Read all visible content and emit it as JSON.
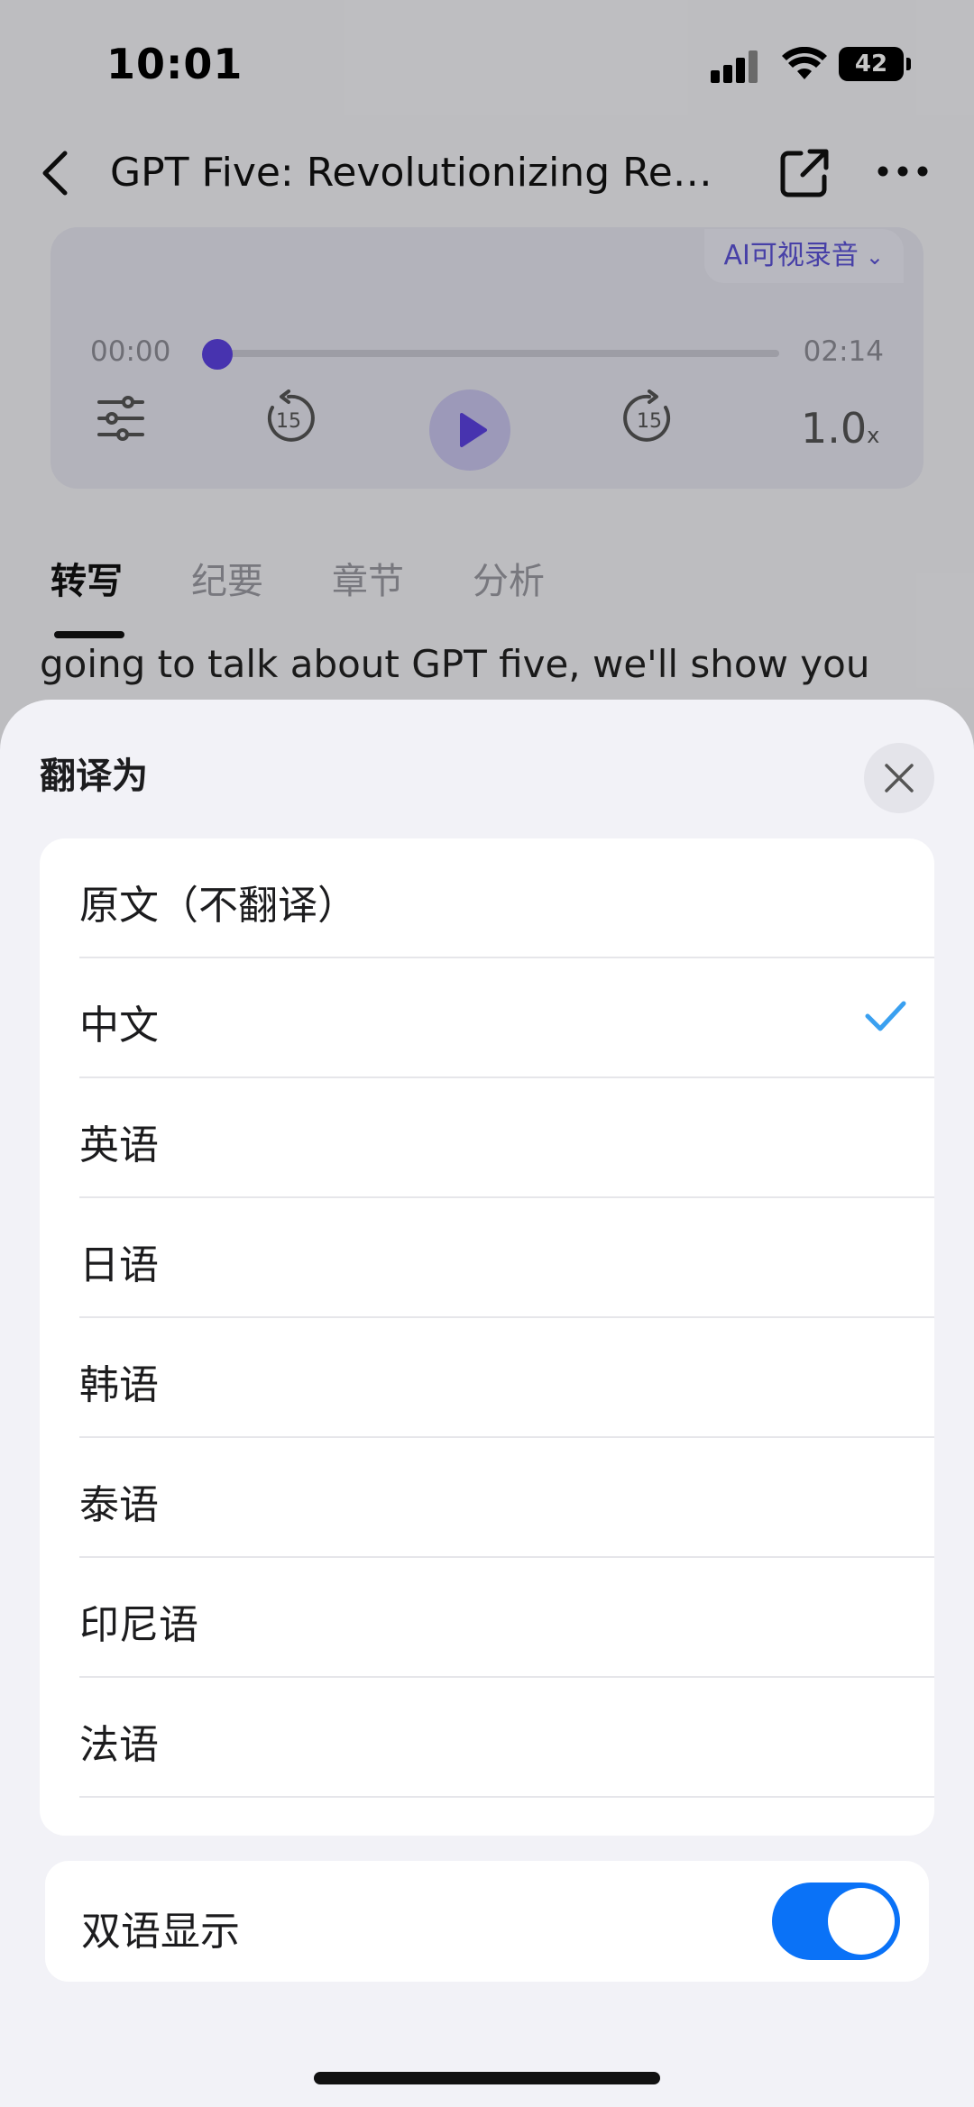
{
  "status_bar": {
    "time": "10:01",
    "battery": "42"
  },
  "nav": {
    "title": "GPT Five: Revolutionizing Rea..."
  },
  "player": {
    "ai_badge": "AI可视录音",
    "time_start": "00:00",
    "time_end": "02:14",
    "progress": 0,
    "rewind_seconds": "15",
    "forward_seconds": "15",
    "speed_value": "1.0",
    "speed_unit": "x"
  },
  "tabs": [
    {
      "label": "转写",
      "active": true
    },
    {
      "label": "纪要",
      "active": false
    },
    {
      "label": "章节",
      "active": false
    },
    {
      "label": "分析",
      "active": false
    }
  ],
  "transcript_preview": "going to talk about GPT five, we'll show you",
  "sheet": {
    "title": "翻译为",
    "languages": [
      {
        "label": "原文（不翻译）",
        "selected": false
      },
      {
        "label": "中文",
        "selected": true
      },
      {
        "label": "英语",
        "selected": false
      },
      {
        "label": "日语",
        "selected": false
      },
      {
        "label": "韩语",
        "selected": false
      },
      {
        "label": "泰语",
        "selected": false
      },
      {
        "label": "印尼语",
        "selected": false
      },
      {
        "label": "法语",
        "selected": false
      }
    ],
    "bilingual_label": "双语显示",
    "bilingual_on": true
  },
  "colors": {
    "accent": "#5b42e0",
    "check": "#3aa0f0",
    "toggle_on": "#0a72f7"
  }
}
